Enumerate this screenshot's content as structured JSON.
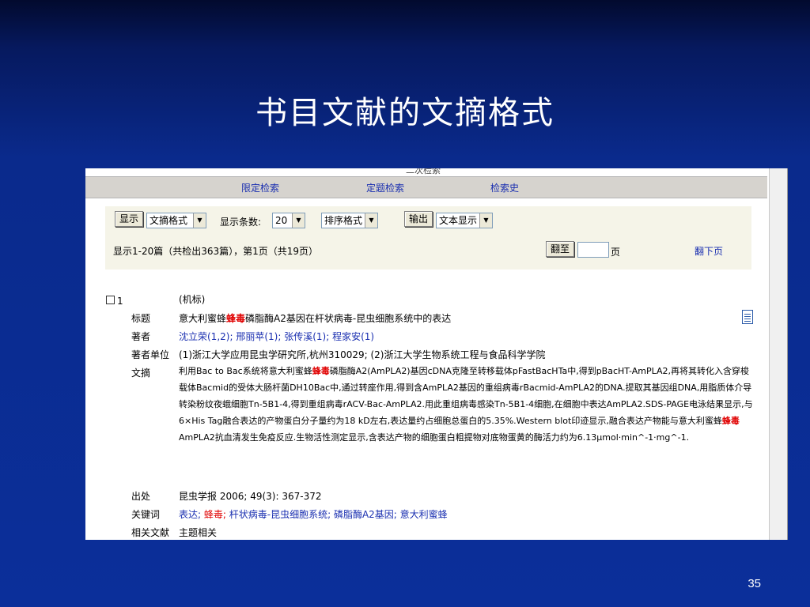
{
  "slide": {
    "title": "书目文献的文摘格式",
    "page_number": "35"
  },
  "header_cut_text": "二次检索",
  "nav": {
    "limit_search": "限定检索",
    "topic_search": "定题检索",
    "search_history": "检索史"
  },
  "toolbar": {
    "display_button": "显示",
    "format_select": "文摘格式",
    "count_label": "显示条数:",
    "count_select": "20",
    "sort_select": "排序格式",
    "output_button": "输出",
    "output_select": "文本显示",
    "status_text": "显示1-20篇（共检出363篇），第1页（共19页）",
    "goto_button": "翻至",
    "page_input_value": "",
    "page_unit": "页",
    "next_page": "翻下页"
  },
  "record": {
    "index": "1",
    "tag": "(机标)",
    "labels": {
      "title": "标题",
      "authors": "著者",
      "affiliation": "著者单位",
      "abstract": "文摘",
      "source": "出处",
      "keywords": "关键词",
      "related": "相关文献"
    },
    "title_parts": [
      "意大利蜜蜂",
      "蜂毒",
      "磷脂酶A2基因在杆状病毒-昆虫细胞系统中的表达"
    ],
    "authors": [
      "沈立荣(1,2);",
      "邢丽苹(1);",
      "张传溪(1);",
      "程家安(1)"
    ],
    "affiliation": "(1)浙江大学应用昆虫学研究所,杭州310029;  (2)浙江大学生物系统工程与食品科学学院",
    "abstract_parts": [
      "利用Bac to Bac系统将意大利蜜蜂",
      "蜂毒",
      "磷脂酶A2(AmPLA2)基因cDNA克隆至转移载体pFastBacHTa中,得到pBacHT-AmPLA2,再将其转化入含穿梭载体Bacmid的受体大肠杆菌DH10Bac中,通过转座作用,得到含AmPLA2基因的重组病毒rBacmid-AmPLA2的DNA.提取其基因组DNA,用脂质体介导转染粉纹夜蛾细胞Tn-5B1-4,得到重组病毒rACV-Bac-AmPLA2.用此重组病毒感染Tn-5B1-4细胞,在细胞中表达AmPLA2.SDS-PAGE电泳结果显示,与6×His Tag融合表达的产物蛋白分子量约为18 kD左右,表达量约占细胞总蛋白的5.35%.Western blot印迹显示,融合表达产物能与意大利蜜蜂",
      "蜂毒",
      "AmPLA2抗血清发生免疫反应.生物活性测定显示,含表达产物的细胞蛋白粗提物对底物蛋黄的酶活力约为6.13μmol·min^-1·mg^-1."
    ],
    "source": "昆虫学报   2006; 49(3): 367-372",
    "keywords": [
      "表达;",
      "蜂毒;",
      "杆状病毒-昆虫细胞系统;",
      "磷脂酶A2基因;",
      "意大利蜜蜂"
    ],
    "related": "主题相关"
  },
  "colors": {
    "link": "#1a2fb0",
    "highlight": "#e00000",
    "related": "#c87800",
    "slide_bg": "#0b2f9a"
  },
  "icons": [
    "checkbox-icon",
    "document-icon",
    "dropdown-arrow-icon"
  ]
}
